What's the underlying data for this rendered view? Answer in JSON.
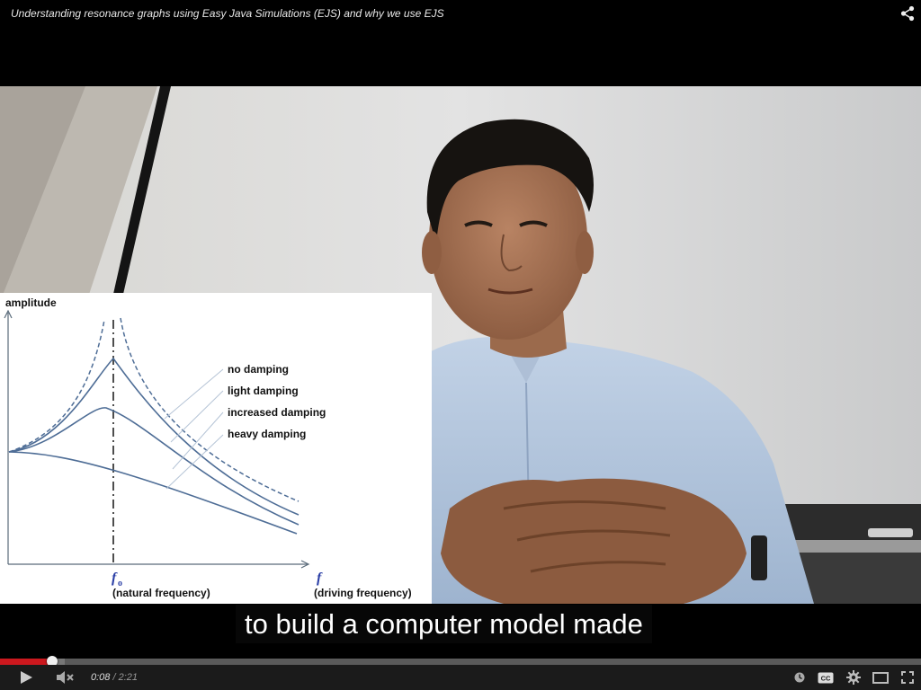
{
  "header": {
    "video_title": "Understanding resonance graphs using Easy Java Simulations (EJS) and why we use EJS",
    "share_icon": "share-icon"
  },
  "video": {
    "scene": "lecturer speaking in office in front of a whiteboard",
    "slide": {
      "y_axis_label": "amplitude",
      "f0_label": "f",
      "f0_subscript": "o",
      "f0_desc": "(natural frequency)",
      "f_label": "f",
      "f_desc": "(driving frequency)",
      "legend": [
        "no damping",
        "light damping",
        "increased damping",
        "heavy damping"
      ]
    }
  },
  "caption": {
    "text": "to build a computer model made"
  },
  "player": {
    "current_time": "0:08",
    "separator": " / ",
    "duration": "2:21",
    "progress_fraction": 0.057,
    "buffered_fraction": 0.07,
    "accent_color": "#cc181e",
    "icons": {
      "play": "play-icon",
      "volume": "volume-muted-icon",
      "watch_later": "watch-later-icon",
      "captions": "captions-icon",
      "settings": "gear-icon",
      "theater": "theater-mode-icon",
      "fullscreen": "fullscreen-icon"
    }
  }
}
